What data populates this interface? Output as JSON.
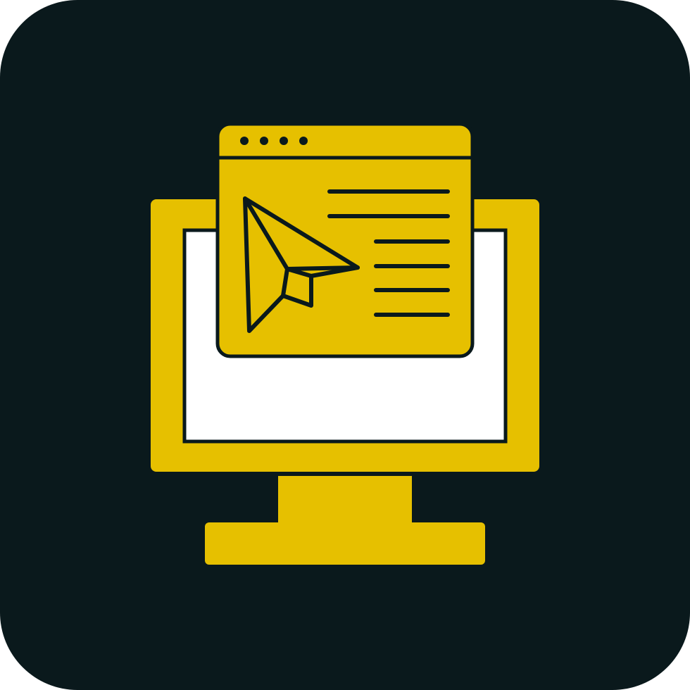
{
  "icon": {
    "name": "computer-send-message-icon",
    "depicts": [
      "monitor-icon",
      "browser-window-icon",
      "paper-plane-icon"
    ]
  },
  "colors": {
    "tile_background": "#0a191c",
    "accent_fill": "#e6c000",
    "screen_fill": "#ffffff",
    "outline": "#0a191c"
  },
  "browser_window": {
    "dot_count": 4,
    "text_line_count": 6
  }
}
